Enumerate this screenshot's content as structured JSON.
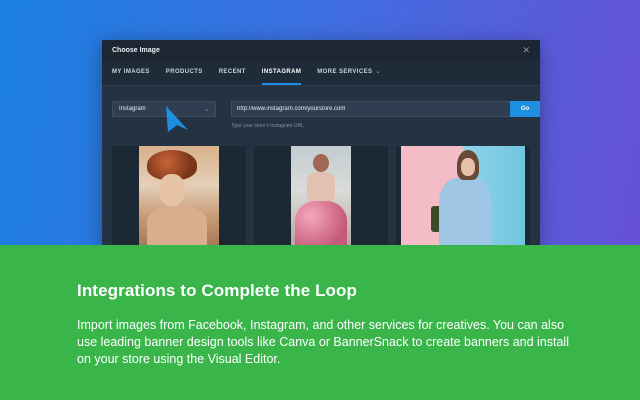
{
  "modal": {
    "title": "Choose Image",
    "tabs": [
      {
        "label": "MY IMAGES",
        "active": false
      },
      {
        "label": "PRODUCTS",
        "active": false
      },
      {
        "label": "RECENT",
        "active": false
      },
      {
        "label": "INSTAGRAM",
        "active": true
      },
      {
        "label": "MORE SERVICES",
        "active": false,
        "has_dropdown": true
      }
    ],
    "source_select": {
      "value": "Instagram"
    },
    "url_input": {
      "value": "http://www.instagram.com/yourstore.com"
    },
    "go_label": "Go",
    "hint": "Type your store's Instagram URL"
  },
  "feature": {
    "title": "Integrations to Complete the Loop",
    "description": "Import images from Facebook, Instagram, and other services for creatives. You can also use leading banner design tools like Canva or BannerSnack to create banners and install on your store using the Visual Editor."
  },
  "colors": {
    "accent": "#1d8fe0",
    "band": "#3ab54a",
    "modal_bg": "#243241"
  },
  "icons": {
    "close": "close-icon",
    "cursor": "cursor-arrow-icon",
    "dropdown": "chevron-down-icon"
  }
}
